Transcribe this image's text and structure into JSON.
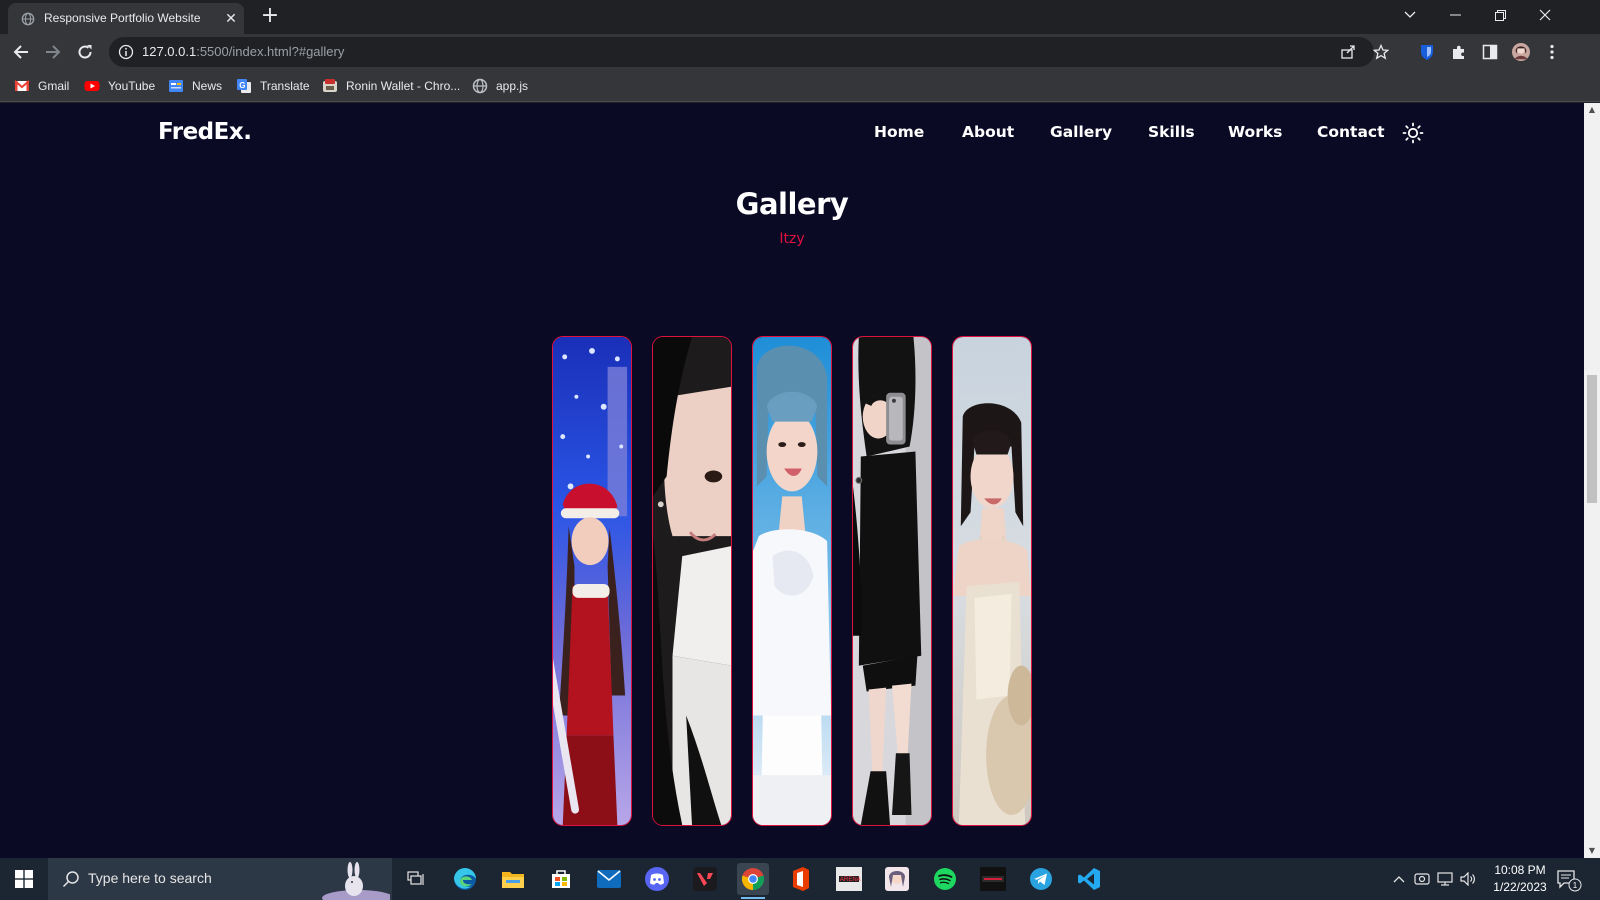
{
  "browser": {
    "tab_title": "Responsive Portfolio Website",
    "url_host": "127.0.0.1",
    "url_rest": ":5500/index.html?#gallery",
    "bookmarks": [
      {
        "label": "Gmail",
        "icon": "gmail-icon"
      },
      {
        "label": "YouTube",
        "icon": "youtube-icon"
      },
      {
        "label": "News",
        "icon": "news-icon"
      },
      {
        "label": "Translate",
        "icon": "translate-icon"
      },
      {
        "label": "Ronin Wallet - Chro...",
        "icon": "ronin-wallet-icon"
      },
      {
        "label": "app.js",
        "icon": "globe-icon"
      }
    ]
  },
  "site": {
    "logo": "FredEx.",
    "nav": [
      "Home",
      "About",
      "Gallery",
      "Skills",
      "Works",
      "Contact"
    ],
    "accent": "#e0103f",
    "background": "#0b0a25"
  },
  "gallery": {
    "title": "Gallery",
    "subtitle": "Itzy",
    "cards": [
      {
        "name": "gallery-photo-1",
        "theme": "winter-santa"
      },
      {
        "name": "gallery-photo-2",
        "theme": "closeup-dark-hair"
      },
      {
        "name": "gallery-photo-3",
        "theme": "blue-hair-white-outfit"
      },
      {
        "name": "gallery-photo-4",
        "theme": "mirror-selfie-black-outfit"
      },
      {
        "name": "gallery-photo-5",
        "theme": "cream-slip-dress"
      }
    ]
  },
  "taskbar": {
    "search_placeholder": "Type here to search",
    "time": "10:08 PM",
    "date": "1/22/2023",
    "notification_count": "1"
  }
}
